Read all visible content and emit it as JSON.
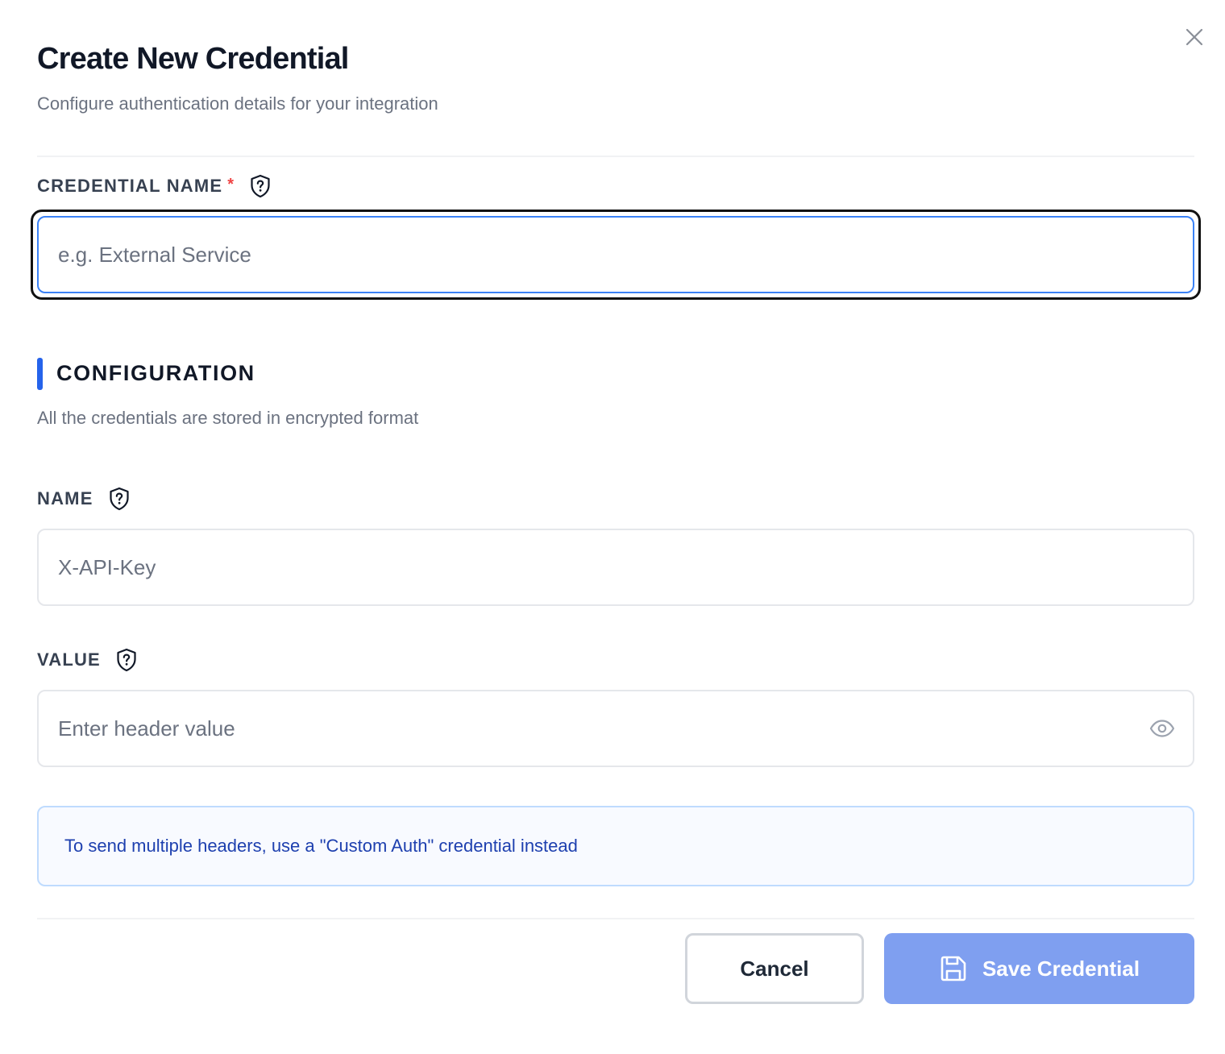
{
  "dialog": {
    "title": "Create New Credential",
    "subtitle": "Configure authentication details for your integration",
    "close_icon": "close-icon"
  },
  "credential_name": {
    "label": "CREDENTIAL NAME",
    "required_mark": "*",
    "help_icon": "shield-question-icon",
    "placeholder": "e.g. External Service",
    "value": ""
  },
  "configuration": {
    "title": "CONFIGURATION",
    "subtitle": "All the credentials are stored in encrypted format",
    "accent_color": "#2563eb"
  },
  "header_name": {
    "label": "NAME",
    "help_icon": "shield-question-icon",
    "placeholder": "X-API-Key",
    "value": ""
  },
  "header_value": {
    "label": "VALUE",
    "help_icon": "shield-question-icon",
    "placeholder": "Enter header value",
    "value": "",
    "toggle_icon": "eye-icon"
  },
  "info": {
    "text": "To send multiple headers, use a \"Custom Auth\" credential instead"
  },
  "actions": {
    "cancel_label": "Cancel",
    "save_label": "Save Credential",
    "save_icon": "floppy-disk-icon",
    "save_color": "#7f9ff0"
  }
}
